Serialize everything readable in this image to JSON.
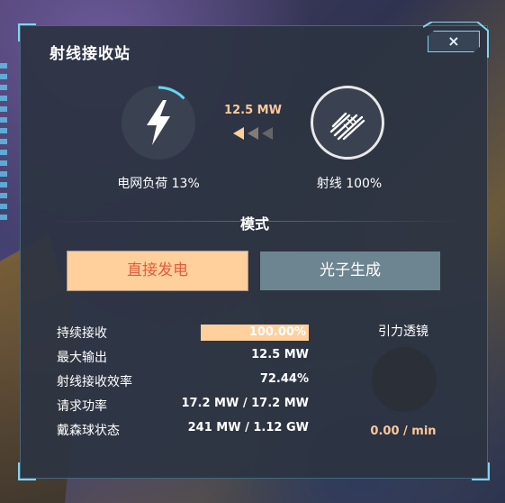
{
  "window": {
    "title": "射线接收站",
    "close_glyph": "×"
  },
  "grid": {
    "icon": "lightning-bolt-icon",
    "label": "电网负荷 13%",
    "load_fraction": 0.13
  },
  "transfer": {
    "power": "12.5 MW",
    "arrows": "flow-left-arrows-icon",
    "accent": "#ffcf9c"
  },
  "ray": {
    "icon": "ray-beam-icon",
    "label": "射线 100%"
  },
  "mode": {
    "title": "模式",
    "options": [
      {
        "label": "直接发电",
        "selected": true
      },
      {
        "label": "光子生成",
        "selected": false
      }
    ]
  },
  "stats": {
    "continuous_receive": {
      "label": "持续接收",
      "value": "100.00%",
      "fraction": 1.0
    },
    "max_output": {
      "label": "最大输出",
      "value": "12.5 MW"
    },
    "efficiency": {
      "label": "射线接收效率",
      "value": "72.44%"
    },
    "request_power": {
      "label": "请求功率",
      "value": "17.2 MW / 17.2 MW"
    },
    "dyson_state": {
      "label": "戴森球状态",
      "value": "241 MW / 1.12 GW"
    }
  },
  "lens": {
    "title": "引力透镜",
    "rate": "0.00 / min"
  },
  "colors": {
    "panel_bg": "#2c3442",
    "frame": "#7fd6f2",
    "selected_button": "#ffcf9c",
    "selected_text": "#e05d3b",
    "unselected_button": "#6d8590",
    "value_accent": "#ffc89a"
  }
}
